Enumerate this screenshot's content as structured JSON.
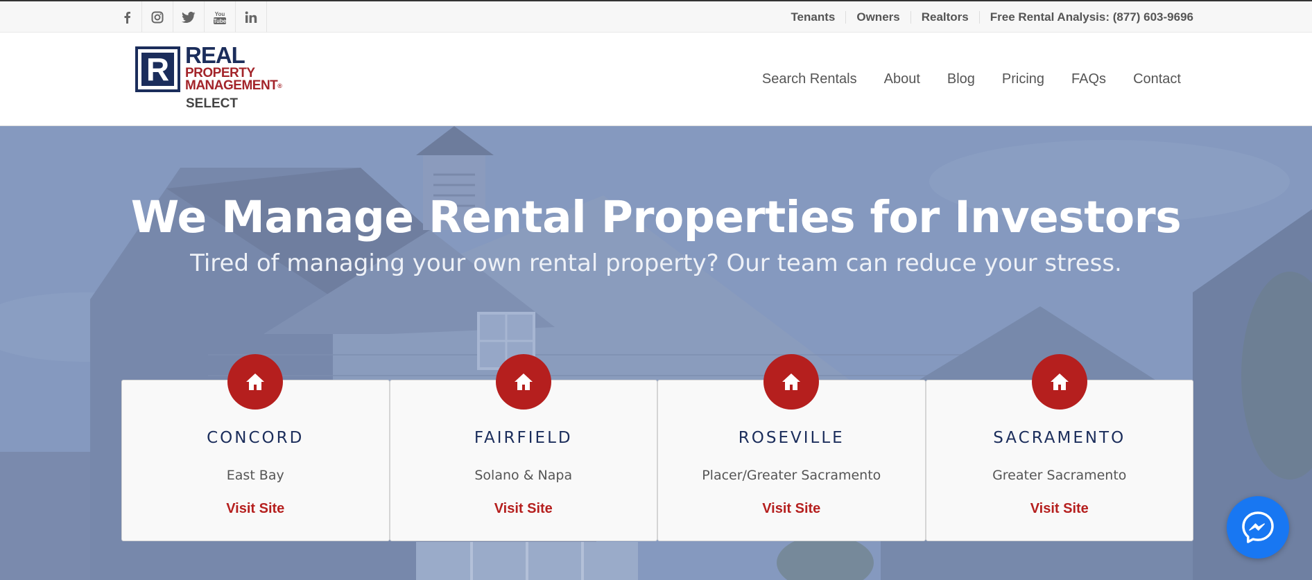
{
  "social": [
    {
      "name": "facebook-icon",
      "glyph": "f"
    },
    {
      "name": "instagram-icon",
      "glyph": "◎"
    },
    {
      "name": "twitter-icon",
      "glyph": "🐦"
    },
    {
      "name": "youtube-icon",
      "glyph": "You Tube"
    },
    {
      "name": "linkedin-icon",
      "glyph": "in"
    }
  ],
  "toplinks": [
    "Tenants",
    "Owners",
    "Realtors",
    "Free Rental Analysis: (877) 603-9696"
  ],
  "logo": {
    "box_letter": "R",
    "real": "REAL",
    "line1": "PROPERTY",
    "line2": "MANAGEMENT",
    "mark": "®",
    "select": "SELECT"
  },
  "nav": [
    "Search Rentals",
    "About",
    "Blog",
    "Pricing",
    "FAQs",
    "Contact"
  ],
  "hero": {
    "title": "We Manage Rental Properties for Investors",
    "subtitle": "Tired of managing your own rental property? Our team can reduce your stress."
  },
  "cards": [
    {
      "city": "CONCORD",
      "region": "East Bay",
      "link": "Visit Site"
    },
    {
      "city": "FAIRFIELD",
      "region": "Solano & Napa",
      "link": "Visit Site"
    },
    {
      "city": "ROSEVILLE",
      "region": "Placer/Greater Sacramento",
      "link": "Visit Site"
    },
    {
      "city": "SACRAMENTO",
      "region": "Greater Sacramento",
      "link": "Visit Site"
    }
  ],
  "colors": {
    "brand_navy": "#1b2d5b",
    "brand_red": "#b51f1e",
    "hero_overlay": "#7e93b9",
    "messenger_blue": "#1877f2"
  }
}
